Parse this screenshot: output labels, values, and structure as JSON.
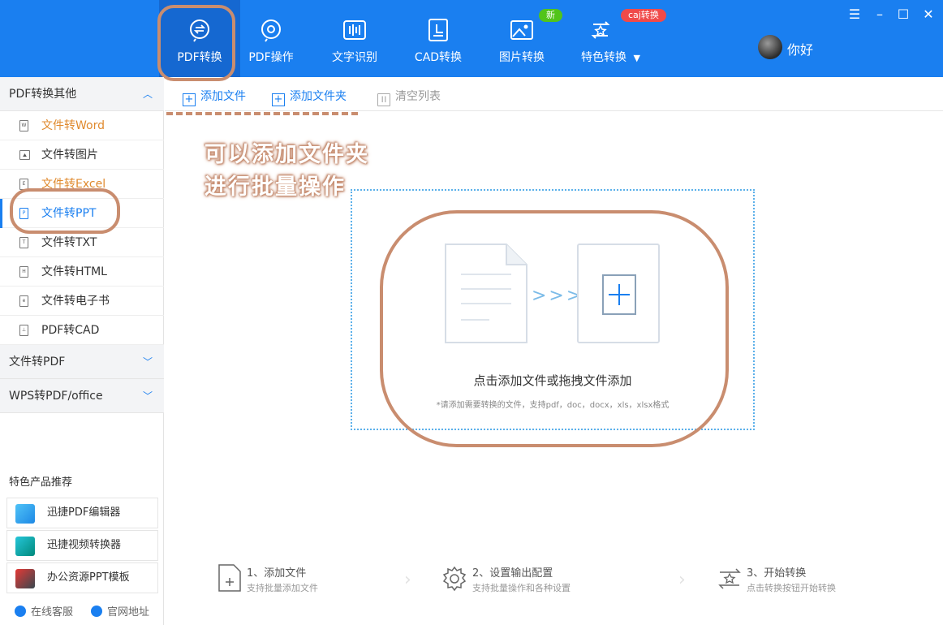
{
  "topbar": {
    "tools": [
      {
        "label": "PDF转换",
        "icon": "pdf-convert-icon",
        "active": true
      },
      {
        "label": "PDF操作",
        "icon": "pdf-operate-icon"
      },
      {
        "label": "文字识别",
        "icon": "ocr-icon"
      },
      {
        "label": "CAD转换",
        "icon": "cad-icon"
      },
      {
        "label": "图片转换",
        "icon": "image-icon"
      },
      {
        "label": "特色转换",
        "icon": "special-icon"
      }
    ],
    "badge_new": "新",
    "badge_caj": "caj转换",
    "username": "你好",
    "colors": {
      "bar": "#1a7ff0",
      "highlight": "#c98d6f",
      "badge_new": "#52c41a",
      "badge_caj": "#f04a4a"
    }
  },
  "sidebar": {
    "section1": "PDF转换其他",
    "items": [
      "文件转Word",
      "文件转图片",
      "文件转Excel",
      "文件转PPT",
      "文件转TXT",
      "文件转HTML",
      "文件转电子书",
      "PDF转CAD"
    ],
    "item_glyphs": [
      "W",
      "",
      "E",
      "P",
      "T",
      "H",
      "e",
      ""
    ],
    "section2": "文件转PDF",
    "section3": "WPS转PDF/office",
    "promo_title": "特色产品推荐",
    "promos": [
      "迅捷PDF编辑器",
      "迅捷视频转换器",
      "办公资源PPT模板"
    ],
    "footer": {
      "service": "在线客服",
      "website": "官网地址"
    }
  },
  "toolbar": {
    "add_file": "添加文件",
    "add_folder": "添加文件夹",
    "clear_list": "清空列表"
  },
  "annotation": {
    "line1": "可以添加文件夹",
    "line2": "进行批量操作"
  },
  "dropzone": {
    "main": "点击添加文件或拖拽文件添加",
    "sub": "*请添加需要转换的文件，支持pdf，doc，docx，xls，xlsx格式"
  },
  "steps": [
    {
      "title": "1、添加文件",
      "desc": "支持批量添加文件"
    },
    {
      "title": "2、设置输出配置",
      "desc": "支持批量操作和各种设置"
    },
    {
      "title": "3、开始转换",
      "desc": "点击转换按钮开始转换"
    }
  ]
}
